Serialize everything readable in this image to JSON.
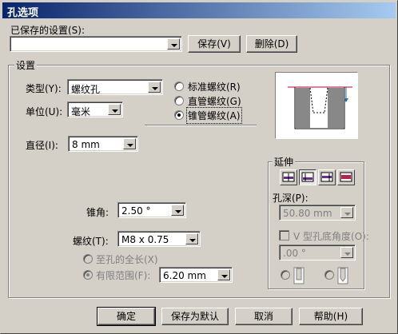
{
  "window": {
    "title": "孔选项"
  },
  "saved_settings": {
    "label": "已保存的设置(S):",
    "value": "",
    "save_button": "保存(V)",
    "delete_button": "删除(D)"
  },
  "settings": {
    "group_title": "设置",
    "type_label": "类型(Y):",
    "type_value": "螺纹孔",
    "unit_label": "单位(U):",
    "unit_value": "毫米",
    "thread_options": [
      "标准螺纹(R)",
      "直管螺纹(G)",
      "锥管螺纹(A)"
    ],
    "thread_selected": 2,
    "diameter_label": "直径(I):",
    "diameter_value": "8 mm",
    "taper_angle_label": "锥角:",
    "taper_angle_value": "2.50 °",
    "thread_label": "螺纹(T):",
    "thread_value": "M8 x 0.75",
    "full_length_label": "至孔的全长(X)",
    "limited_range_label": "有限范围(F):",
    "limited_range_value": "6.20 mm"
  },
  "extend": {
    "group_title": "延伸",
    "depth_label": "孔深(P):",
    "depth_value": "50.80 mm",
    "v_angle_label": "V 型孔底角度(O):",
    "v_angle_value": ".00 °"
  },
  "buttons": {
    "ok": "确定",
    "save_default": "保存为默认",
    "cancel": "取消",
    "help": "帮助(H)"
  }
}
